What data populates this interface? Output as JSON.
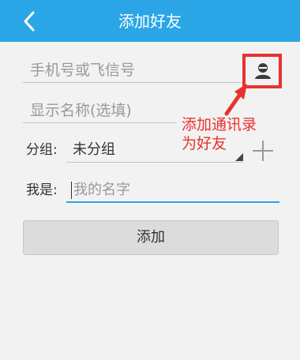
{
  "header": {
    "title": "添加好友"
  },
  "form": {
    "phone_placeholder": "手机号或飞信号",
    "display_name_placeholder": "显示名称(选填)",
    "group_label": "分组:",
    "group_value": "未分组",
    "me_label": "我是:",
    "my_name_placeholder": "我的名字",
    "submit_label": "添加"
  },
  "annotation": {
    "line1": "添加通讯录",
    "line2": "为好友",
    "color": "#e8322e"
  },
  "theme": {
    "accent": "#2aa6e6"
  },
  "icons": {
    "back": "chevron-left-icon",
    "contacts": "contact-book-icon",
    "add_group": "plus-icon"
  }
}
